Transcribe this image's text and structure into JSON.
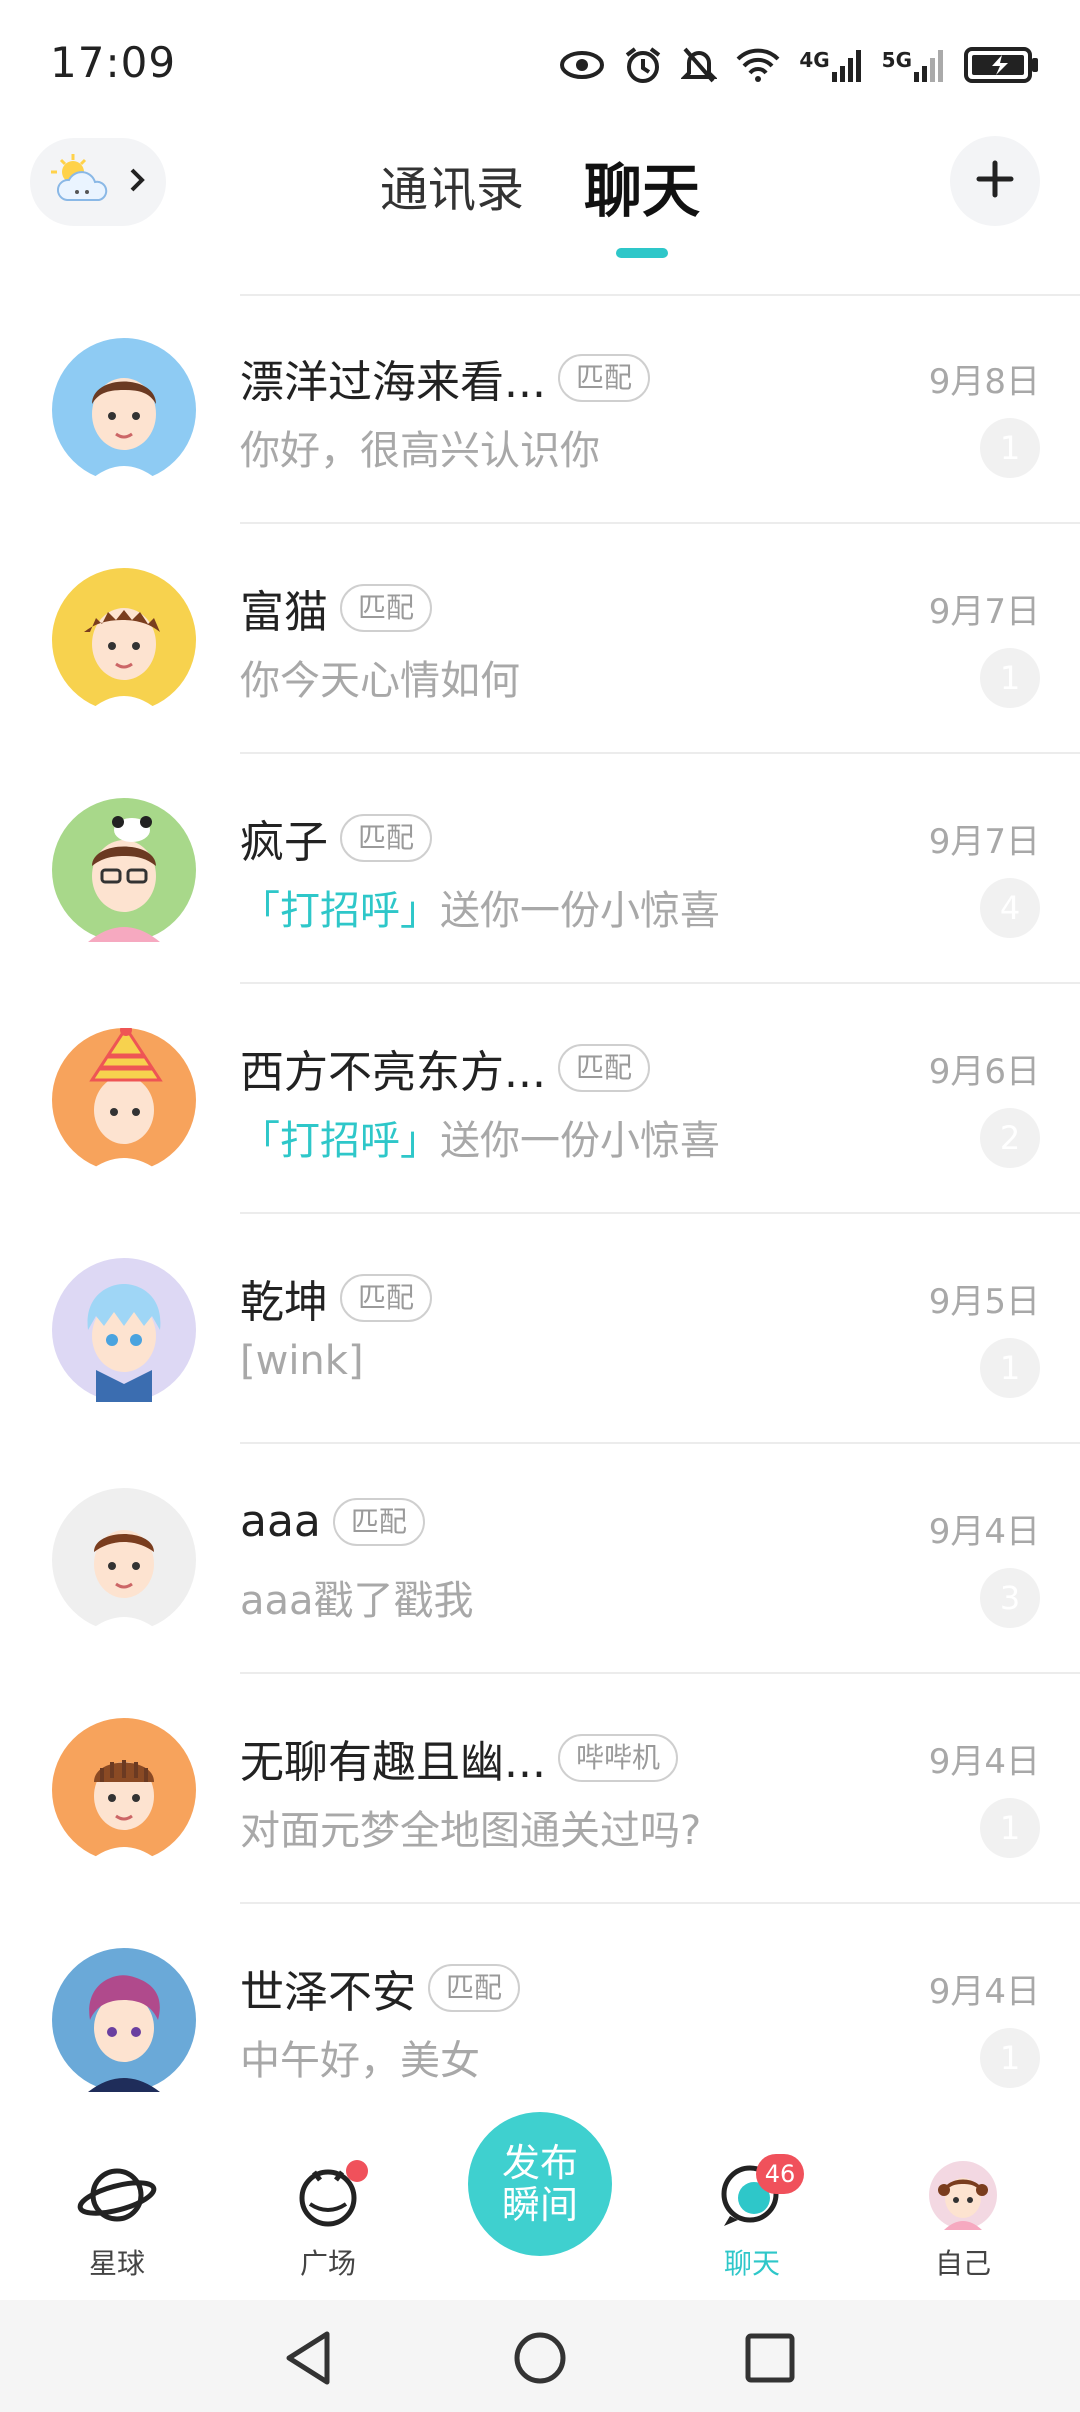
{
  "status_bar": {
    "time": "17:09",
    "icons": [
      "eye-icon",
      "alarm-icon",
      "mute-icon",
      "wifi-icon",
      "4g-signal-icon",
      "5g-signal-icon",
      "battery-charging-icon"
    ],
    "network_4g": "4G",
    "network_5g": "5G"
  },
  "header": {
    "weather_icon": "sun-cloud-icon",
    "tabs": [
      {
        "label": "通讯录",
        "active": false
      },
      {
        "label": "聊天",
        "active": true
      }
    ],
    "add_icon": "plus-icon"
  },
  "chats": [
    {
      "name": "漂洋过海来看...",
      "tag": "匹配",
      "date": "9月8日",
      "message_highlight": "",
      "message": "你好，很高兴认识你",
      "unread": "1",
      "avatar_bg": "#8ecbf3"
    },
    {
      "name": "富猫",
      "tag": "匹配",
      "date": "9月7日",
      "message_highlight": "",
      "message": "你今天心情如何",
      "unread": "1",
      "avatar_bg": "#f7d24e"
    },
    {
      "name": "疯子",
      "tag": "匹配",
      "date": "9月7日",
      "message_highlight": "「打招呼」",
      "message": "送你一份小惊喜",
      "unread": "4",
      "avatar_bg": "#a8d88a"
    },
    {
      "name": "西方不亮东方...",
      "tag": "匹配",
      "date": "9月6日",
      "message_highlight": "「打招呼」",
      "message": "送你一份小惊喜",
      "unread": "2",
      "avatar_bg": "#f7a35c"
    },
    {
      "name": "乾坤",
      "tag": "匹配",
      "date": "9月5日",
      "message_highlight": "",
      "message": "[wink]",
      "unread": "1",
      "avatar_bg": "#ddd8f4"
    },
    {
      "name": "aaa",
      "tag": "匹配",
      "date": "9月4日",
      "message_highlight": "",
      "message": "aaa戳了戳我",
      "unread": "3",
      "avatar_bg": "#efefef"
    },
    {
      "name": "无聊有趣且幽...",
      "tag": "哔哔机",
      "date": "9月4日",
      "message_highlight": "",
      "message": "对面元梦全地图通关过吗?",
      "unread": "1",
      "avatar_bg": "#f7a35c"
    },
    {
      "name": "世泽不安",
      "tag": "匹配",
      "date": "9月4日",
      "message_highlight": "",
      "message": "中午好，美女",
      "unread": "1",
      "avatar_bg": "#6aa9d8"
    }
  ],
  "bottom_nav": {
    "items": [
      {
        "label": "星球",
        "icon": "planet-icon"
      },
      {
        "label": "广场",
        "icon": "square-icon"
      },
      {
        "label": "聊天",
        "icon": "chat-icon",
        "badge": "46",
        "active": true
      },
      {
        "label": "自己",
        "icon": "profile-avatar-icon"
      }
    ],
    "publish_line1": "发布",
    "publish_line2": "瞬间"
  },
  "system_nav": [
    "back-icon",
    "home-icon",
    "recents-icon"
  ],
  "colors": {
    "accent": "#2ec7c9",
    "badge_red": "#f0515b"
  }
}
